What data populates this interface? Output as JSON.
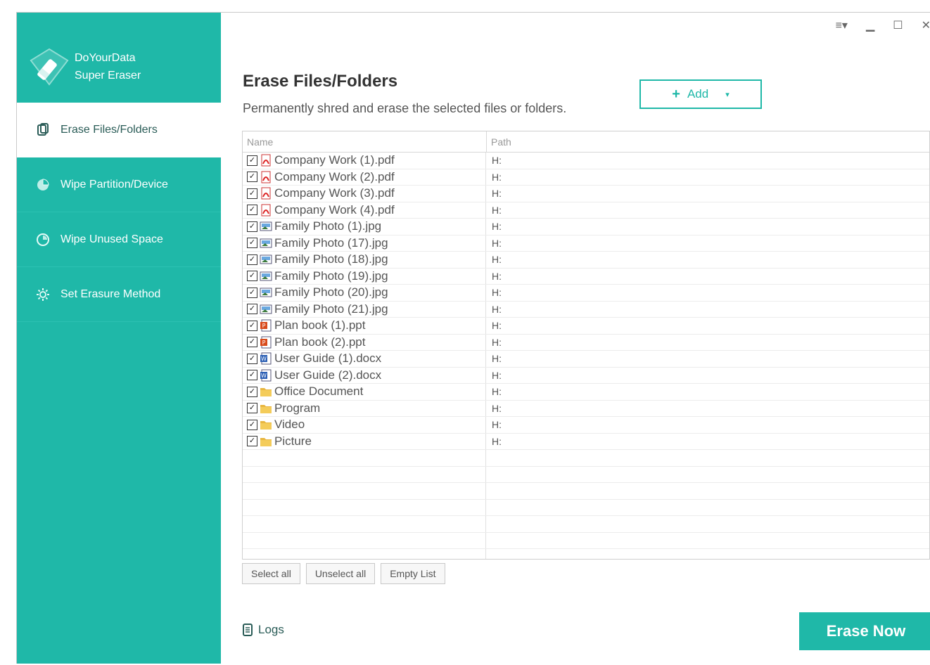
{
  "app": {
    "name_line1": "DoYourData",
    "name_line2": "Super Eraser"
  },
  "nav": [
    {
      "label": "Erase Files/Folders",
      "icon": "erase-files-icon",
      "active": true
    },
    {
      "label": "Wipe Partition/Device",
      "icon": "partition-icon",
      "active": false
    },
    {
      "label": "Wipe Unused Space",
      "icon": "unused-space-icon",
      "active": false
    },
    {
      "label": "Set Erasure Method",
      "icon": "gear-icon",
      "active": false
    }
  ],
  "window_controls": {
    "menu": "≡▾",
    "minimize": "▁",
    "maximize": "☐",
    "close": "✕"
  },
  "main": {
    "title": "Erase Files/Folders",
    "subtitle": "Permanently shred and erase the selected files or folders.",
    "add_label": "Add",
    "columns": {
      "name": "Name",
      "path": "Path"
    },
    "rows": [
      {
        "name": "Company Work (1).pdf",
        "path": "H:",
        "type": "pdf"
      },
      {
        "name": "Company Work (2).pdf",
        "path": "H:",
        "type": "pdf"
      },
      {
        "name": "Company Work (3).pdf",
        "path": "H:",
        "type": "pdf"
      },
      {
        "name": "Company Work (4).pdf",
        "path": "H:",
        "type": "pdf"
      },
      {
        "name": "Family Photo (1).jpg",
        "path": "H:",
        "type": "jpg"
      },
      {
        "name": "Family Photo (17).jpg",
        "path": "H:",
        "type": "jpg"
      },
      {
        "name": "Family Photo (18).jpg",
        "path": "H:",
        "type": "jpg"
      },
      {
        "name": "Family Photo (19).jpg",
        "path": "H:",
        "type": "jpg"
      },
      {
        "name": "Family Photo (20).jpg",
        "path": "H:",
        "type": "jpg"
      },
      {
        "name": "Family Photo (21).jpg",
        "path": "H:",
        "type": "jpg"
      },
      {
        "name": "Plan book (1).ppt",
        "path": "H:",
        "type": "ppt"
      },
      {
        "name": "Plan book (2).ppt",
        "path": "H:",
        "type": "ppt"
      },
      {
        "name": "User Guide (1).docx",
        "path": "H:",
        "type": "docx"
      },
      {
        "name": "User Guide (2).docx",
        "path": "H:",
        "type": "docx"
      },
      {
        "name": "Office Document",
        "path": "H:",
        "type": "folder"
      },
      {
        "name": "Program",
        "path": "H:",
        "type": "folder"
      },
      {
        "name": "Video",
        "path": "H:",
        "type": "folder"
      },
      {
        "name": "Picture",
        "path": "H:",
        "type": "folder"
      }
    ],
    "buttons": {
      "select_all": "Select all",
      "unselect_all": "Unselect all",
      "empty_list": "Empty List"
    },
    "logs_label": "Logs",
    "erase_label": "Erase Now"
  },
  "colors": {
    "accent": "#1fb8a8"
  }
}
